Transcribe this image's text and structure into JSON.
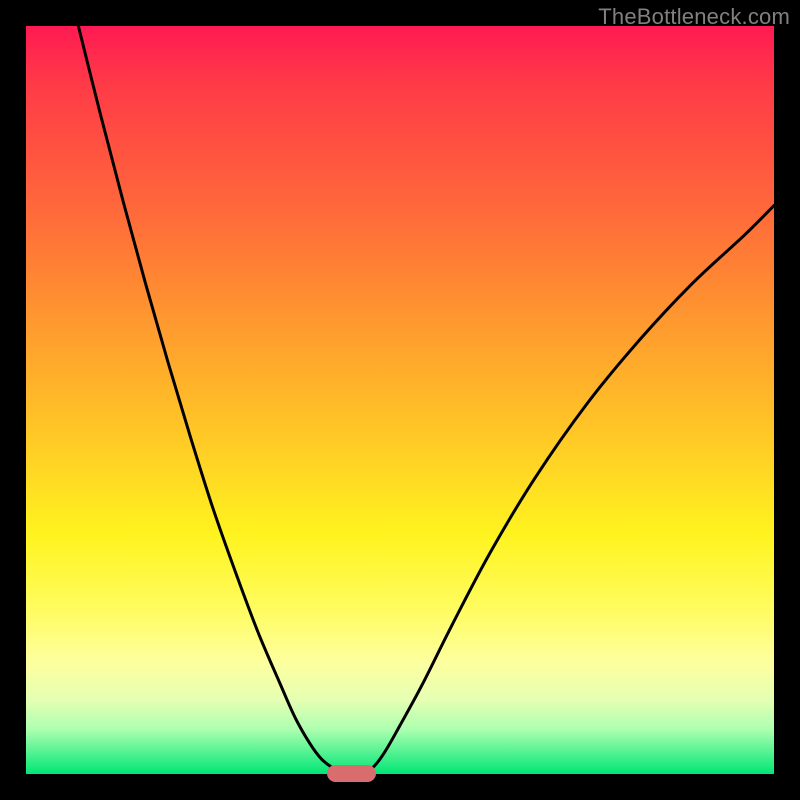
{
  "watermark": "TheBottleneck.com",
  "colors": {
    "frame_bg_top": "#ff1a53",
    "frame_bg_bottom": "#00e676",
    "curve": "#000000",
    "marker": "#d96d6d",
    "page_bg": "#000000",
    "watermark": "#808080"
  },
  "chart_data": {
    "type": "line",
    "title": "",
    "xlabel": "",
    "ylabel": "",
    "xlim": [
      0,
      100
    ],
    "ylim": [
      0,
      100
    ],
    "grid": false,
    "legend": false,
    "series": [
      {
        "name": "left-branch",
        "x": [
          7,
          10,
          13,
          16,
          19,
          22,
          25,
          28,
          31,
          34,
          36,
          38,
          39.5,
          41,
          42
        ],
        "y": [
          100,
          88,
          76.5,
          65.5,
          55,
          45,
          35.5,
          27,
          19,
          12,
          7.5,
          4,
          2,
          0.8,
          0
        ]
      },
      {
        "name": "right-branch",
        "x": [
          45,
          46.5,
          48,
          50,
          53,
          57,
          62,
          68,
          75,
          82,
          89,
          96,
          100
        ],
        "y": [
          0,
          1,
          3,
          6.5,
          12,
          20,
          29.5,
          39.5,
          49.5,
          58,
          65.5,
          72,
          76
        ]
      }
    ],
    "annotations": [
      {
        "name": "minimum-marker",
        "x_center": 43.5,
        "width_pct": 6.5,
        "y": 0
      }
    ]
  }
}
